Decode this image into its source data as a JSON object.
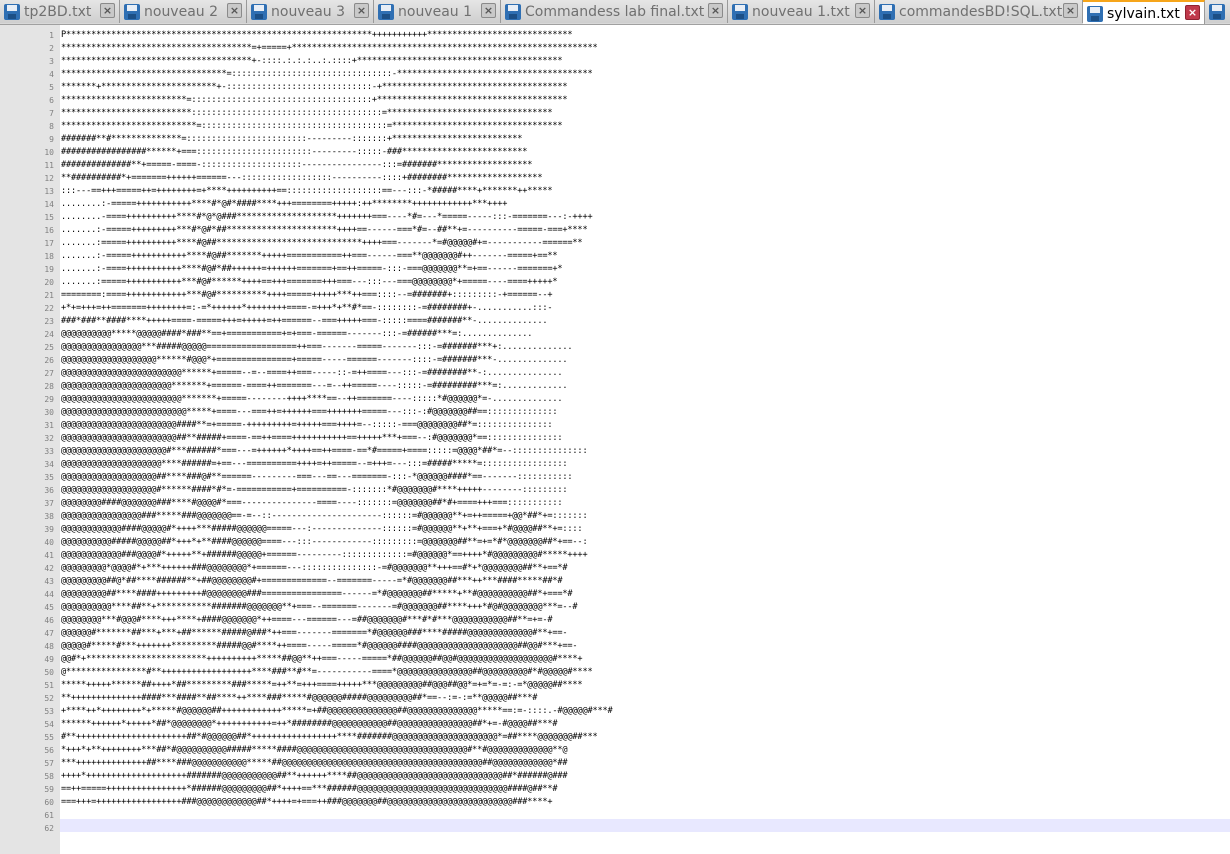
{
  "tabs": [
    {
      "label": "tp2BD.txt",
      "width": 120,
      "active": false
    },
    {
      "label": "nouveau 2",
      "width": 127,
      "active": false
    },
    {
      "label": "nouveau 3",
      "width": 127,
      "active": false
    },
    {
      "label": "nouveau 1",
      "width": 127,
      "active": false
    },
    {
      "label": "Commandess lab final.txt",
      "width": 227,
      "active": false
    },
    {
      "label": "nouveau 1.txt",
      "width": 147,
      "active": false
    },
    {
      "label": "commandesBD!SQL.txt",
      "width": 208,
      "active": false
    },
    {
      "label": "sylvain.txt",
      "width": 122,
      "active": true
    },
    {
      "label": "",
      "width": 40,
      "active": false
    }
  ],
  "editor": {
    "line_numbers": [
      "1",
      "2",
      "3",
      "4",
      "5",
      "6",
      "7",
      "8",
      "9",
      "10",
      "11",
      "12",
      "13",
      "14",
      "15",
      "16",
      "17",
      "18",
      "19",
      "20",
      "21",
      "22",
      "23",
      "24",
      "25",
      "26",
      "27",
      "28",
      "29",
      "30",
      "31",
      "32",
      "33",
      "34",
      "35",
      "36",
      "37",
      "38",
      "39",
      "40",
      "41",
      "42",
      "43",
      "44",
      "45",
      "46",
      "47",
      "48",
      "49",
      "50",
      "51",
      "52",
      "53",
      "54",
      "55",
      "56",
      "57",
      "58",
      "59",
      "60",
      "61",
      "62"
    ],
    "current_line": "62",
    "lines": [
      "P*************************************************************+++++++++++*****************************",
      "**************************************=+=====+*************************************************************",
      "**************************************+-::::.:.:.:..:.::::+*****************************************",
      "*********************************=::::::::::::::::::::::::::::::::-***************************************",
      "*******+***********************+-:::::::::::::::::::::::::::::-+*************************************",
      "*************************=::::::::::::::::::::::::::::::::::::+**************************************",
      "**************************::::::::::::::::::::::::::::::::::::::=*********************************",
      "***************************=:::::::::::::::::::::::::::::::::::::=**********************************",
      "#######**#**************=::::::::::::::::::::::::---------:::::::+**************************",
      "#################******+===:::::::::::::::::::::::---------:::::-###*************************",
      "##############**+=====-====-::::::::::::::::::::----------------:::=#######*******************",
      "**##########*+=======++++++======---::::::::::::::::::----------::::+########*******************",
      ":::---==+++=====++=++++++++=+****++++++++++==:::::::::::::::::::==---:::-*#####****+*******++*****",
      "........:-=====+++++++++++****#*@#*####****+++========+++++:++********++++++++++++***++++",
      "........-====++++++++++****#*@*@###********************+++++++===----*#=---*=====-----:::-=======---:-++++",
      ".......:-=====+++++++++***#*@#*##**********************++++==------===*#=--##**+=----------=====-===+****",
      ".......:=====++++++++++****#@##*****************************++++===-------*=#@@@@@#+=-----------======**",
      ".......:-=====+++++++++++****#@##*******+++++===========++===------===**@@@@@@@#++-------=====+==**",
      ".......:-====+++++++++++****#@#*##++++++=++++++=======+==++=====-:::-===@@@@@@@**=+==------=======+*",
      ".......:=====+++++++++++***#@#******++++==+++=======+++===---:::---===@@@@@@@@*+=====----====+++++*",
      "========:====++++++++++++***#@#**********++++=====+++++***++===::::--=#######+:::::::::-+======--+",
      "+*+=+++=++=======++++++++=:-=*++++++*++++++++====-=+++*+**#*==-::::::::-=########+-...........:::-",
      "###*###**####****+++++====-=====+++=+++++=++======--===+++++===-:::::====#######**-..............",
      "@@@@@@@@@@*****@@@@@####*###**==+===========+=+===-======-------:::-=######***=:..............",
      "@@@@@@@@@@@@@@@@***#####@@@@@==================++===-------=====-------:::-=#######***+:..............",
      "@@@@@@@@@@@@@@@@@@@******#@@@*+===============+=====-----======-------::::-=#######***-..............",
      "@@@@@@@@@@@@@@@@@@@@@@@@******+=====--=--====++===-----::-=++====---:::-=########**-:...............",
      "@@@@@@@@@@@@@@@@@@@@@@*******+======-====++=======---=--++=====----:::::-=#########***=:.............",
      "@@@@@@@@@@@@@@@@@@@@@@@@*******+=====--------++++****==--++=======----:::::*#@@@@@@*=-..............",
      "@@@@@@@@@@@@@@@@@@@@@@@@@*****+====---===++=++++++===+++++++=====---:::-:#@@@@@@@##==::::::::::::::",
      "@@@@@@@@@@@@@@@@@@@@@@@####**=+=====-+++++++++=+++++===++++=--:::::-===@@@@@@@@##*=:::::::::::::::",
      "@@@@@@@@@@@@@@@@@@@@@@@##**#####+====-==++====+++++++++++==+++++***+===--:#@@@@@@@*==:::::::::::::::",
      "@@@@@@@@@@@@@@@@@@@@@#***######*===---=++++++*++++==++====-==*#=====+====:::::=@@@@*##*=--:::::::::::::::",
      "@@@@@@@@@@@@@@@@@@@@****######=+==---==========++++=++=====--=+++=---:::=#####*****=:::::::::::::::::",
      "@@@@@@@@@@@@@@@@@@@##****###@#**======---------===---==---=======-:::-*@@@@@@####*==-------:::::::::::",
      "@@@@@@@@@@@@@@@@@@@#******####*#*=-===========+==========-:::::::*#@@@@@@@#****+++++--------:::::::::",
      "@@@@@@@@####@@@@@@@###****#@@@@#*===---------------====----:::::::=@@@@@@@##*#+====+++===:::::::::::",
      "@@@@@@@@@@@@@@@@###*****###@@@@@@@==-=--::----------------------::::::=#@@@@@@**+=++=====+@@*##*+=:::::::",
      "@@@@@@@@@@@@####@@@@@#*++++***#####@@@@@@=====---:--------------::::::=#@@@@@@**+**+===+*#@@@@##**+=::::",
      "@@@@@@@@@@#####@@@@@##*+++*+**####@@@@@@====---:::------------:::::::::=@@@@@@@##**=+=*#*@@@@@@@##*+==--:",
      "@@@@@@@@@@@@###@@@@#*+++++**+######@@@@@+======---------:::::::::::::=#@@@@@@*==++++*#@@@@@@@@@#*****++++",
      "@@@@@@@@@*@@@@#*+***++++++###@@@@@@@@*+======---:::::::::::::::-=#@@@@@@@**+++==#*+*@@@@@@@@##**+==*#",
      "@@@@@@@@@##@*##****######**+##@@@@@@@@#+=============--=======-----=*#@@@@@@@##***++***####*****##*#",
      "@@@@@@@@@##****####+++++++++#@@@@@@@@###================------=*#@@@@@@@##*****+**#@@@@@@@@@@##*+===*#",
      "@@@@@@@@@@****##**+***********#######@@@@@@@**+===--=======-------=#@@@@@@@##****+++*#@#@@@@@@@@***=--#",
      "@@@@@@@@***#@@@#****+++****+####@@@@@@@*++====---======---=##@@@@@@@#***#*#***@@@@@@@@@@@##**=+=-#",
      "@@@@@@#*******##***+***+##******#####@###*++===-------=======*#@@@@@@###****#####@@@@@@@@@@@@@#**+==-",
      "@@@@@#*****#***+++++++*********#####@@#****++====-----=====*#@@@@@@####@@@@@@@@@@@@@@@@@@@@##@@#***+==-",
      "@@#*+************************++++++++++*****##@@**++===-----=====*##@@@@@@##@@#@@@@@@@@@@@@@@@@@@@#****+",
      "@****************#**++++++++++++++++++****###**#**=-----------====*@@@@@@@@@@@@@@@##@@@@@@@@@#*#@@@@@#****",
      "*****+++++******##++++*##*********###*****=++**=+++====+++++***@@@@@@@@@##@@@##@@*=+=*=-=:-=*@@@@@##****",
      "**++++++++++++++####***####**##****++****###*****#@@@@@@#####@@@@@@@@@##*==--:=-:=**@@@@@##***#",
      "+****++*++++++++*+*****#@@@@@@##++++++++++++*****=+##@@@@@@@@@@@@@@##@@@@@@@@@@@@@@*****==:=-::::.-#@@@@@#***#",
      "******++++++*+++++*##*@@@@@@@@*+++++++++++=++*########@@@@@@@@@@@##@@@@@@@@@@@@@@@##*+=-#@@@@##***#",
      "#**++++++++++++++++++++++##*#@@@@@@##*+++++++++++++++++****#######@@@@@@@@@@@@@@@@@@@@@*=##****@@@@@@@##***",
      "*+++*+**++++++++***##*#@@@@@@@@@@#####*****####@@@@@@@@@@@@@@@@@@@@@@@@@@@@@@@@@@#**#@@@@@@@@@@@@@**@",
      "***++++++++++++++##****###@@@@@@@@@@@*****##@@@@@@@@@@@@@@@@@@@@@@@@@@@@@@@@@@@@@@@@##@@@@@@@@@@@@*##",
      "++++*++++++++++++++++++++#######@@@@@@@@@@@##**++++++****##@@@@@@@@@@@@@@@@@@@@@@@@@@@@@##*######@###",
      "==++=====++++++++++++++++*######@@@@@@@@@##*++++==***######@@@@@@@@@@@@@@@@@@@@@@@@@@@@@@####@##**#",
      "===+++=+++++++++++++++++###@@@@@@@@@@@@##*++++=+===++###@@@@@@@##@@@@@@@@@@@@@@@@@@@@@@@@@###****+",
      "",
      "",
      ""
    ]
  }
}
